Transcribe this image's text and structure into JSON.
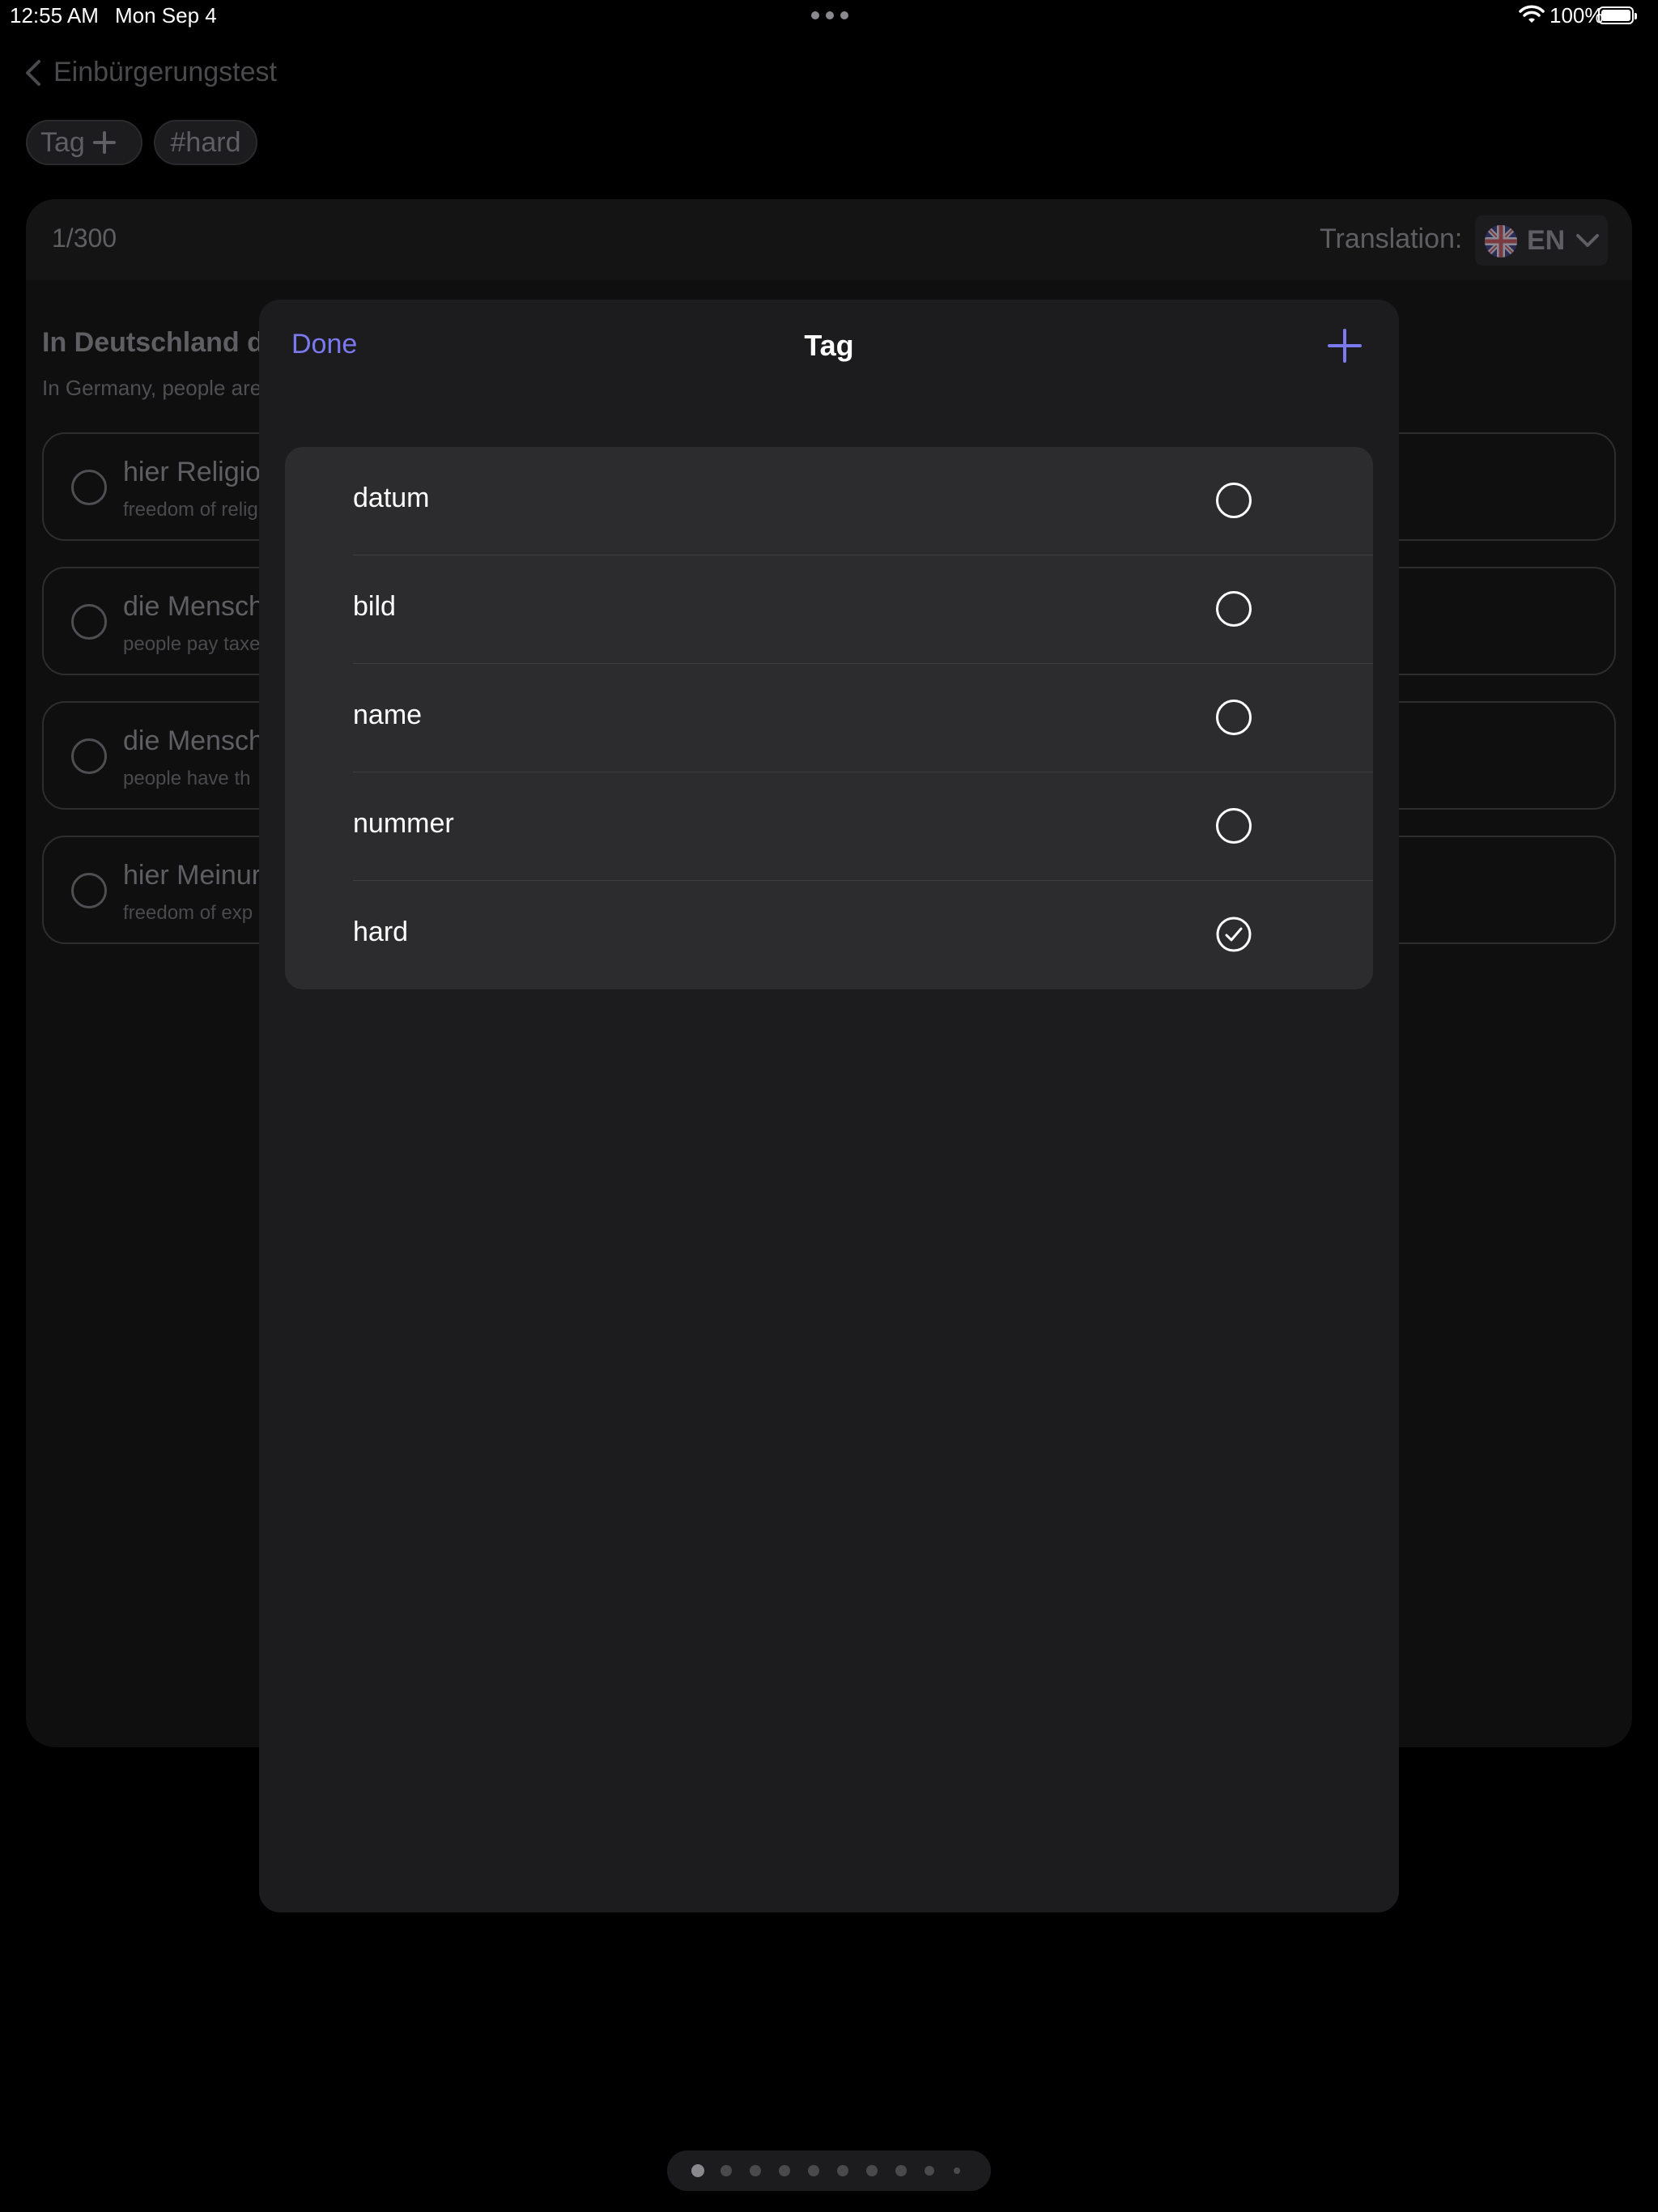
{
  "status_bar": {
    "time": "12:55 AM",
    "date": "Mon Sep 4",
    "battery": "100%"
  },
  "nav": {
    "back_title": "Einbürgerungstest"
  },
  "tags_bar": {
    "tag_chip_label": "Tag",
    "active_tag": "#hard"
  },
  "card": {
    "counter": "1/300",
    "translation_label": "Translation:",
    "language_code": "EN",
    "question": "In Deutschland d",
    "question_translation": "In Germany, people are",
    "options": [
      {
        "main": "hier Religio",
        "sub": "freedom of relig"
      },
      {
        "main": "die Mensch",
        "sub": "people pay taxe"
      },
      {
        "main": "die Mensch",
        "sub": "people have th"
      },
      {
        "main": "hier Meinur",
        "sub": "freedom of exp"
      }
    ]
  },
  "sheet": {
    "done_label": "Done",
    "title": "Tag",
    "tags": [
      {
        "label": "datum",
        "selected": false
      },
      {
        "label": "bild",
        "selected": false
      },
      {
        "label": "name",
        "selected": false
      },
      {
        "label": "nummer",
        "selected": false
      },
      {
        "label": "hard",
        "selected": true
      }
    ]
  },
  "pager": {
    "page_count": 10,
    "current_page": 1
  },
  "colors": {
    "accent": "#7b79f0",
    "sheet_bg": "#1c1c1e",
    "list_bg": "#2c2c2e"
  }
}
